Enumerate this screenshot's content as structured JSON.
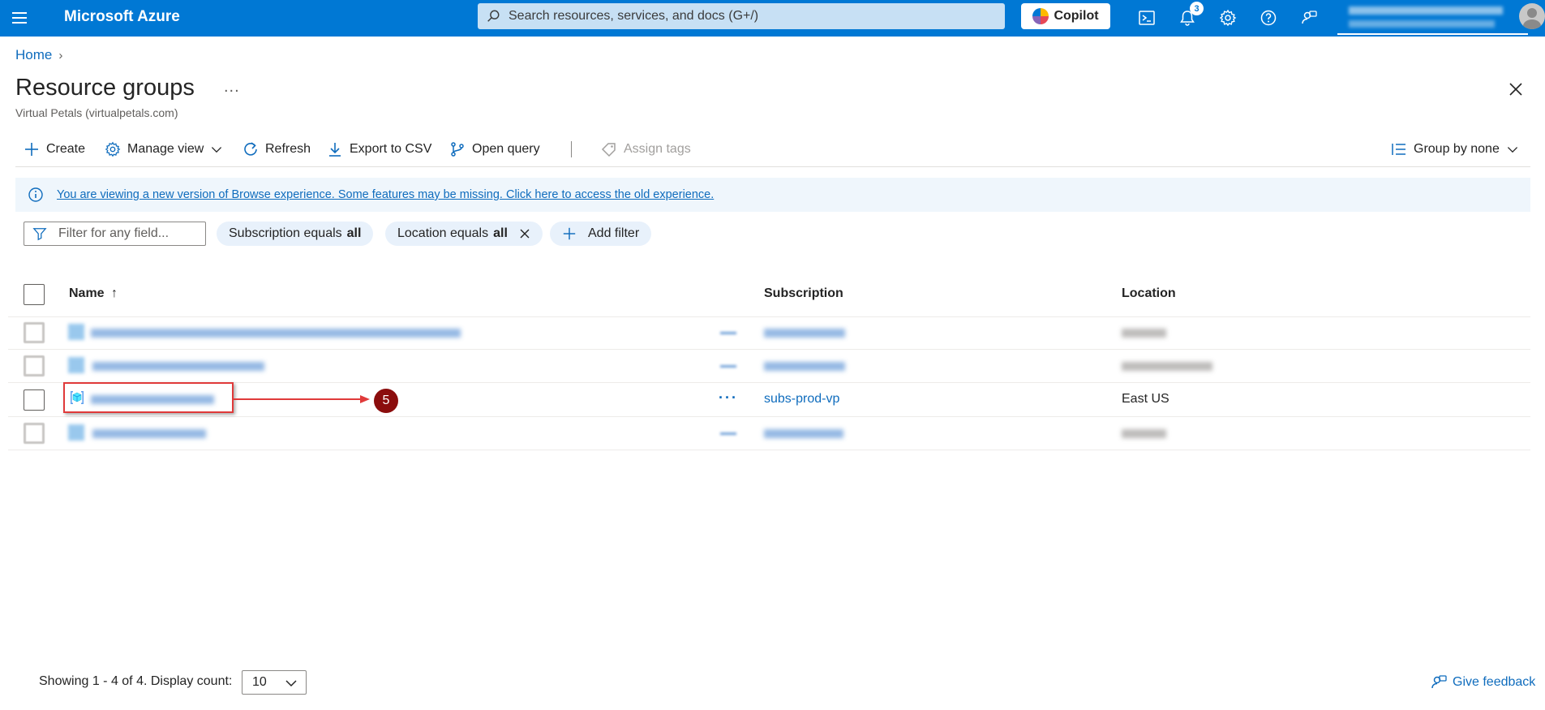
{
  "topbar": {
    "brand": "Microsoft Azure",
    "search_placeholder": "Search resources, services, and docs (G+/)",
    "copilot_label": "Copilot",
    "notifications_count": "3",
    "accent_color": "#0078d4"
  },
  "breadcrumb": {
    "home": "Home"
  },
  "page": {
    "title": "Resource groups",
    "more": "...",
    "subtitle": "Virtual Petals (virtualpetals.com)"
  },
  "toolbar": {
    "create": "Create",
    "manage_view": "Manage view",
    "refresh": "Refresh",
    "export_csv": "Export to CSV",
    "open_query": "Open query",
    "assign_tags": "Assign tags",
    "group_by": "Group by none"
  },
  "banner": {
    "message": "You are viewing a new version of Browse experience. Some features may be missing. Click here to access the old experience."
  },
  "filters": {
    "placeholder": "Filter for any field...",
    "subscription_prefix": "Subscription equals",
    "subscription_value": "all",
    "location_prefix": "Location equals",
    "location_value": "all",
    "add_filter": "Add filter"
  },
  "table": {
    "columns": {
      "name": "Name",
      "sort_indicator": "↑",
      "subscription": "Subscription",
      "location": "Location"
    },
    "visible_row": {
      "more": "···",
      "subscription": "subs-prod-vp",
      "location": "East US"
    }
  },
  "annotation": {
    "step": "5",
    "color": "#e03a3a"
  },
  "footer": {
    "showing": "Showing 1 - 4 of 4. Display count:",
    "display_count": "10",
    "feedback": "Give feedback"
  }
}
